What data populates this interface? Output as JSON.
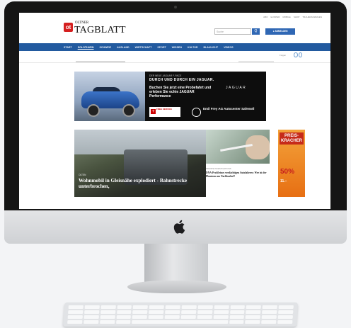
{
  "site": {
    "logo_badge": "ot",
    "logo_top": "OLTNER",
    "logo_main": "TAGBLATT",
    "top_links": [
      "ABO",
      "E-PAPER",
      "MOBILE",
      "SHOP",
      "TRAUERANZEIGEN"
    ],
    "search_placeholder": "Suche",
    "search_button": "Q",
    "login_label": "ANMELDEN",
    "menu": [
      "START",
      "SOLOTHURN",
      "SCHWEIZ",
      "AUSLAND",
      "WIRTSCHAFT",
      "SPORT",
      "WISSEN",
      "KULTUR",
      "BLAULICHT",
      "VIDEOS"
    ],
    "active_menu": "SOLOTHURN",
    "follow_text": "Folgen"
  },
  "ad": {
    "tagline": "DER NEUE JAGUAR F-PACE",
    "headline": "DURCH UND DURCH EIN JAGUAR.",
    "cta": "Buchen Sie jetzt eine Probefahrt und erleben Sie echte JAGUAR Performance",
    "brand": "JAGUAR",
    "service": "FREE SERVICE",
    "dealer": "Emil Frey AG Autocenter Safenwil"
  },
  "news": [
    {
      "kicker": "OLTEN",
      "title": "Wohnmobil in Gleisnähe explodiert - Bahnstrecke unterbrochen,"
    },
    {
      "kicker": "PRIVATE INVESTIGATIONS",
      "title": "DNA-Profil eines verdächtigen Autofahrers: Wer ist der Phantom aus Nachbarhof?"
    }
  ],
  "promo": {
    "head": "PREIS-KRACHER",
    "percent": "50%",
    "price": "11.–"
  },
  "colors": {
    "brand_red": "#d51f1f",
    "nav_blue": "#225a9f",
    "button_blue": "#2f67b4"
  },
  "icons": [
    "apple-icon",
    "search-icon",
    "user-icon",
    "facebook-icon",
    "twitter-icon"
  ]
}
